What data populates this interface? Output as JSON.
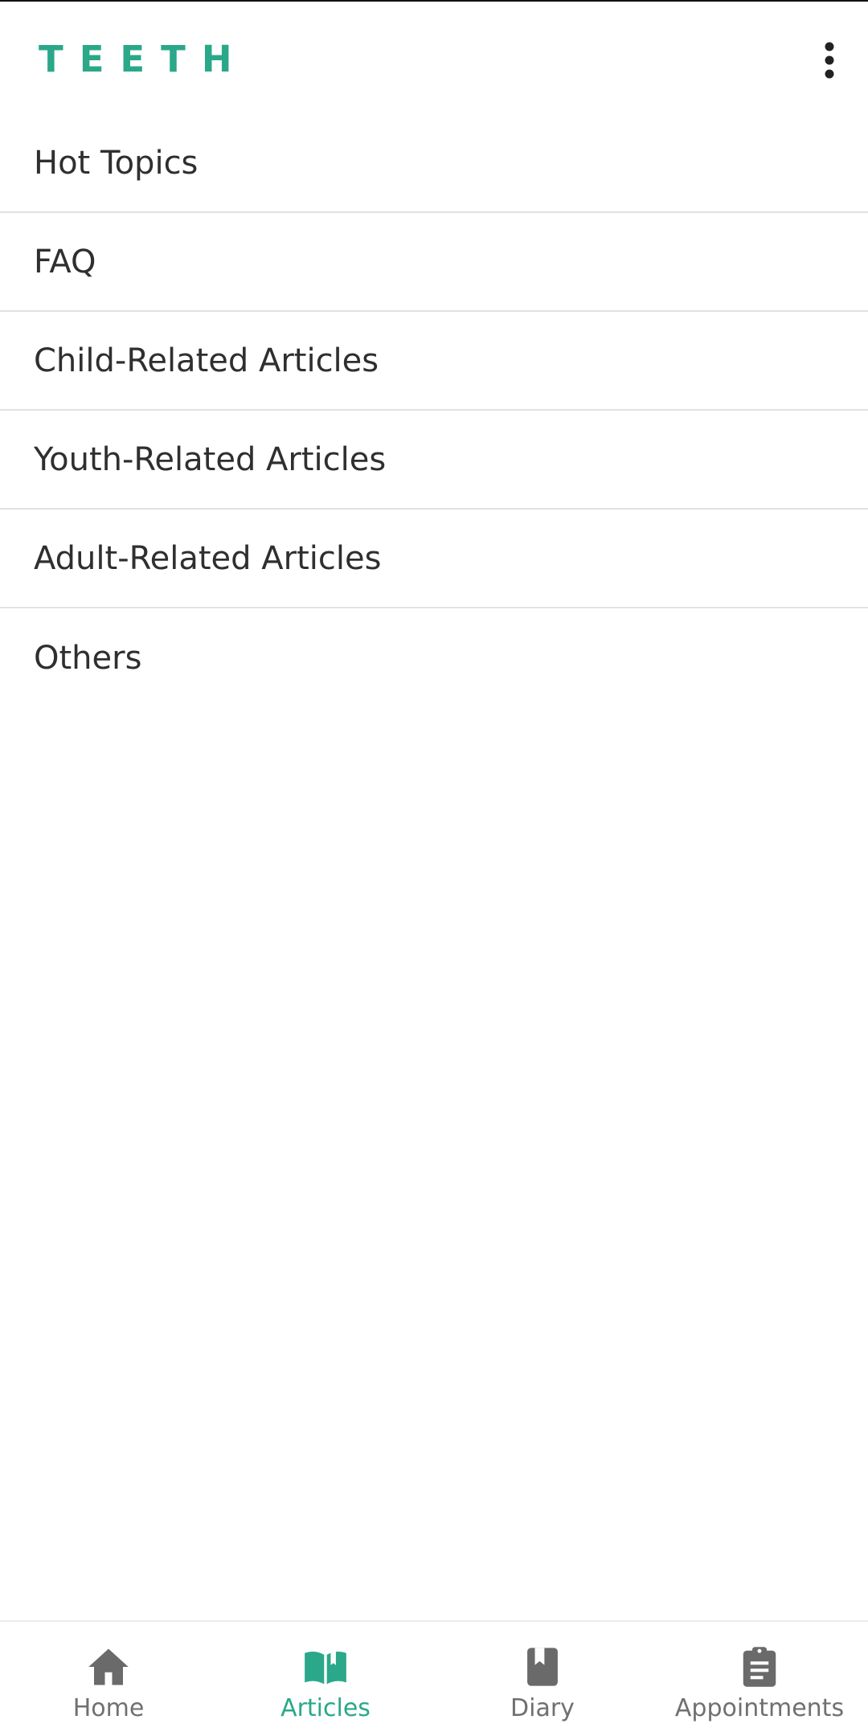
{
  "app_bar": {
    "title": "TEETH",
    "menu_icon": "more-vertical-icon"
  },
  "categories": [
    {
      "label": "Hot Topics"
    },
    {
      "label": "FAQ"
    },
    {
      "label": "Child-Related Articles"
    },
    {
      "label": "Youth-Related Articles"
    },
    {
      "label": "Adult-Related Articles"
    },
    {
      "label": "Others"
    }
  ],
  "bottom_nav": {
    "active": "Articles",
    "items": [
      {
        "label": "Home",
        "icon": "home-icon"
      },
      {
        "label": "Articles",
        "icon": "open-book-icon"
      },
      {
        "label": "Diary",
        "icon": "diary-book-icon"
      },
      {
        "label": "Appointments",
        "icon": "clipboard-icon"
      }
    ]
  },
  "colors": {
    "accent": "#2aa889",
    "inactive": "#707070",
    "divider": "#e2e2e2"
  }
}
